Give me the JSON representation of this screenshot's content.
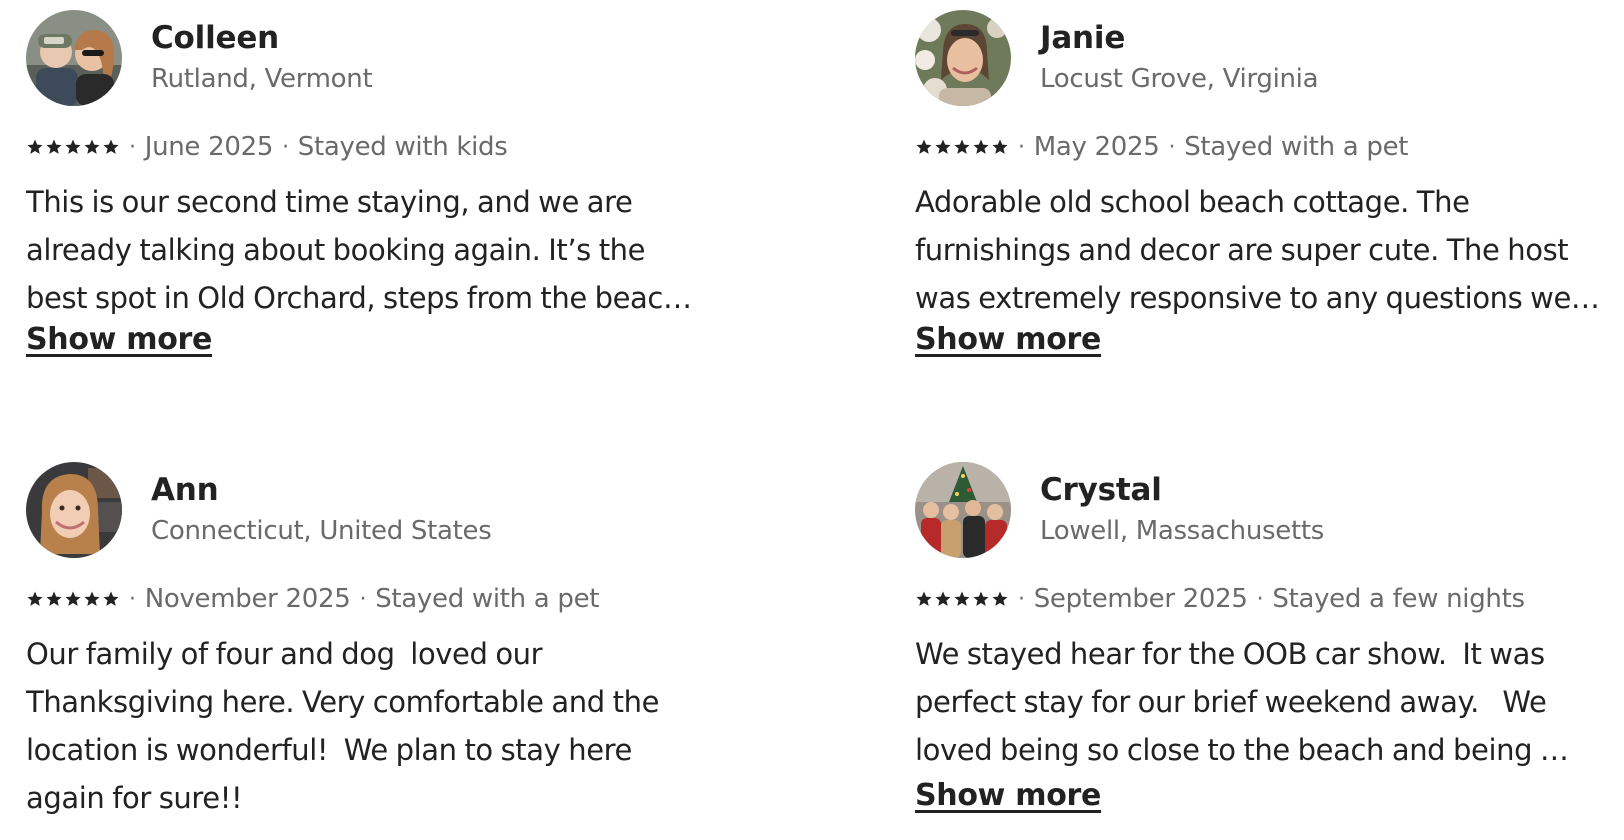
{
  "reviews": [
    {
      "name": "Colleen",
      "location": "Rutland, Vermont",
      "rating_stars": 5,
      "date": "June 2025",
      "stay_type": "Stayed with kids",
      "text_lines": [
        "This is our second time staying, and we are",
        "already talking about booking again. It’s the",
        "best spot in Old Orchard, steps from the beac…"
      ],
      "show_more": "Show more",
      "avatar_icon": "user-photo-avatar"
    },
    {
      "name": "Janie",
      "location": "Locust Grove, Virginia",
      "rating_stars": 5,
      "date": "May 2025",
      "stay_type": "Stayed with a pet",
      "text_lines": [
        "Adorable old school beach cottage. The",
        "furnishings and decor are super cute. The host",
        "was extremely responsive to any questions we…"
      ],
      "show_more": "Show more",
      "avatar_icon": "user-photo-avatar"
    },
    {
      "name": "Ann",
      "location": "Connecticut, United States",
      "rating_stars": 5,
      "date": "November 2025",
      "stay_type": "Stayed with a pet",
      "text_lines": [
        "Our family of four and dog  loved our",
        "Thanksgiving here. Very comfortable and the",
        "location is wonderful!  We plan to stay here",
        "again for sure!!"
      ],
      "show_more": "",
      "avatar_icon": "user-photo-avatar"
    },
    {
      "name": "Crystal",
      "location": "Lowell, Massachusetts",
      "rating_stars": 5,
      "date": "September 2025",
      "stay_type": "Stayed a few nights",
      "text_lines": [
        "We stayed hear for the OOB car show.  It was",
        "perfect stay for our brief weekend away.   We",
        "loved being so close to the beach and being …"
      ],
      "show_more": "Show more",
      "avatar_icon": "user-photo-avatar"
    }
  ],
  "colors": {
    "text_primary": "#222222",
    "text_secondary": "#6a6a6a",
    "background": "#ffffff"
  }
}
